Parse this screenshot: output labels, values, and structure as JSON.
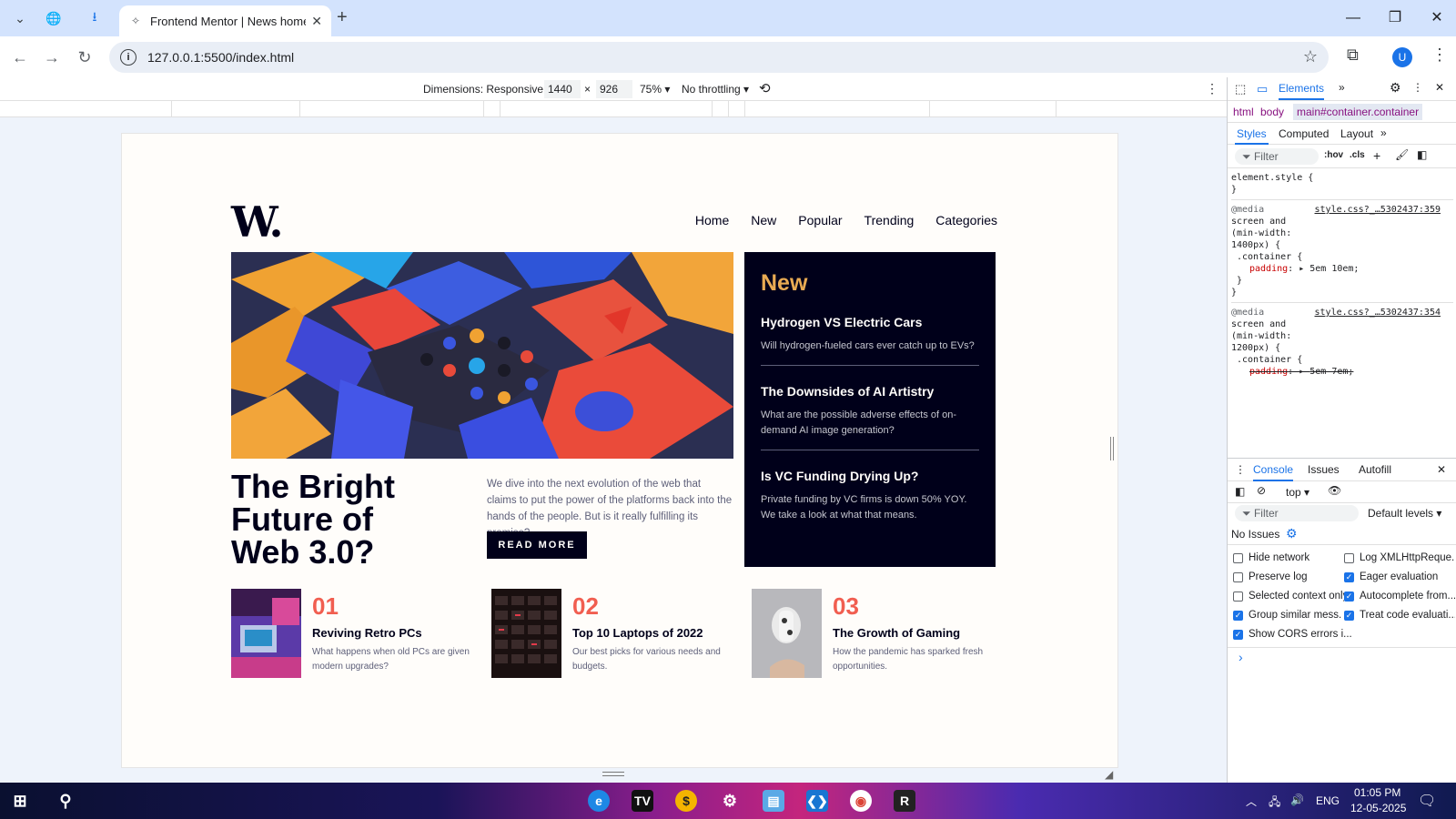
{
  "browser": {
    "tab_title": "Frontend Mentor | News homep",
    "url": "127.0.0.1:5500/index.html",
    "avatar_letter": "U"
  },
  "device_toolbar": {
    "dimensions_label": "Dimensions: Responsive ▾",
    "width": "1440",
    "times": "×",
    "height": "926",
    "zoom": "75% ▾",
    "throttling": "No throttling ▾"
  },
  "site": {
    "logo": "W.",
    "nav": [
      "Home",
      "New",
      "Popular",
      "Trending",
      "Categories"
    ],
    "hero": {
      "title": "The Bright Future of Web 3.0?",
      "text": "We dive into the next evolution of the web that claims to put the power of the platforms back into the hands of the people. But is it really fulfilling its promise?",
      "button": "READ MORE"
    },
    "new_section": {
      "heading": "New",
      "articles": [
        {
          "title": "Hydrogen VS Electric Cars",
          "desc": "Will hydrogen-fueled cars ever catch up to EVs?"
        },
        {
          "title": "The Downsides of AI Artistry",
          "desc": "What are the possible adverse effects of on-demand AI image generation?"
        },
        {
          "title": "Is VC Funding Drying Up?",
          "desc": "Private funding by VC firms is down 50% YOY. We take a look at what that means."
        }
      ]
    },
    "cards": [
      {
        "num": "01",
        "title": "Reviving Retro PCs",
        "desc": "What happens when old PCs are given modern upgrades?"
      },
      {
        "num": "02",
        "title": "Top 10 Laptops of 2022",
        "desc": "Our best picks for various needs and budgets."
      },
      {
        "num": "03",
        "title": "The Growth of Gaming",
        "desc": "How the pandemic has sparked fresh opportunities."
      }
    ]
  },
  "devtools": {
    "panel_tab": "Elements",
    "crumbs": [
      "html",
      "body",
      "main#container.container"
    ],
    "subtabs": [
      "Styles",
      "Computed",
      "Layout"
    ],
    "filter_placeholder": "Filter",
    "hov": ":hov",
    "cls": ".cls",
    "styles": {
      "element_style": "element.style {",
      "close_brace": "}",
      "rule1": {
        "media": "@media",
        "cond1": "screen and",
        "cond2": "(min-width:",
        "cond3": "1400px) {",
        "link": "style.css?_…5302437:359",
        "selector": ".container {",
        "prop": "padding",
        "value": "5em 10em;"
      },
      "rule2": {
        "media": "@media",
        "cond1": "screen and",
        "cond2": "(min-width:",
        "cond3": "1200px) {",
        "link": "style.css?_…5302437:354",
        "selector": ".container {",
        "prop": "padding",
        "value": "5em 7em;"
      }
    },
    "console": {
      "tabs": [
        "Console",
        "Issues",
        "Autofill"
      ],
      "context": "top ▾",
      "filter": "Filter",
      "levels": "Default levels ▾",
      "no_issues": "No Issues",
      "options": [
        {
          "label": "Hide network",
          "checked": false
        },
        {
          "label": "Log XMLHttpReque...",
          "checked": false
        },
        {
          "label": "Preserve log",
          "checked": false
        },
        {
          "label": "Eager evaluation",
          "checked": true
        },
        {
          "label": "Selected context only",
          "checked": false
        },
        {
          "label": "Autocomplete from...",
          "checked": true
        },
        {
          "label": "Group similar mess...",
          "checked": true
        },
        {
          "label": "Treat code evaluati...",
          "checked": true
        },
        {
          "label": "Show CORS errors i...",
          "checked": true
        }
      ],
      "prompt": "›"
    }
  },
  "taskbar": {
    "time": "01:05 PM",
    "date": "12-05-2025",
    "lang": "ENG"
  },
  "colors": {
    "accent_orange": "#e9ab53",
    "accent_red": "#f15e50",
    "dark_navy": "#00001a",
    "chrome_blue": "#1a73e8"
  }
}
